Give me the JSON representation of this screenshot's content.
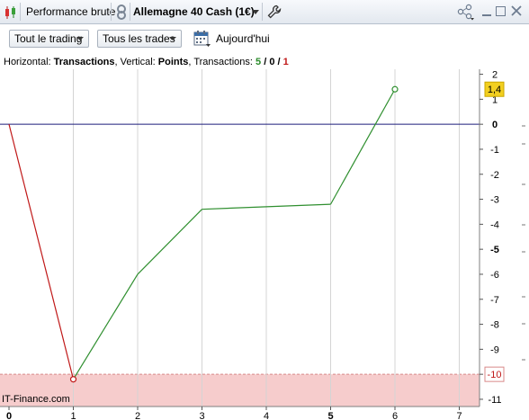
{
  "titlebar": {
    "perf_label": "Performance brute",
    "instrument": "Allemagne 40 Cash (1€)",
    "icons": [
      "candlestick-icon",
      "link-icon",
      "wrench-icon",
      "share-icon",
      "minimize-icon",
      "maximize-icon",
      "close-icon"
    ]
  },
  "toolbar": {
    "scope_select": "Tout le trading",
    "trades_select": "Tous les trades",
    "date_label": "Aujourd'hui"
  },
  "info": {
    "horizontal_label": "Horizontal: ",
    "horizontal_value": "Transactions",
    "vertical_label": ", Vertical: ",
    "vertical_value": "Points",
    "transactions_label": ", Transactions: ",
    "winners": "5",
    "slash1": " / ",
    "neutral": "0",
    "slash2": " / ",
    "losers": "1"
  },
  "colors": {
    "gain_line": "#2f8f2f",
    "loss_line": "#c01818",
    "zero_line": "#1c1c7a",
    "loss_zone": "#f6cccc",
    "last_value_badge": "#f2cf1f"
  },
  "chart_data": {
    "type": "line",
    "x": [
      0,
      1,
      2,
      3,
      4,
      5,
      6
    ],
    "y": [
      0,
      -10.2,
      -6.0,
      -3.4,
      -3.3,
      -3.2,
      1.4
    ],
    "segment_colors": [
      "loss",
      "gain",
      "gain",
      "gain",
      "gain",
      "gain"
    ],
    "markers": [
      1,
      6
    ],
    "xlim": [
      0,
      7.3
    ],
    "ylim": [
      -11.3,
      2.2
    ],
    "x_ticks": [
      "0",
      "1",
      "2",
      "3",
      "4",
      "5",
      "6",
      "7"
    ],
    "y_ticks": [
      "2",
      "1",
      "0",
      "-1",
      "-2",
      "-3",
      "-4",
      "-5",
      "-6",
      "-7",
      "-8",
      "-9",
      "-10",
      "-11"
    ],
    "bold_x_ticks": [
      "0",
      "5"
    ],
    "bold_y_ticks": [
      "0",
      "-5"
    ],
    "last_value_label": "1,4",
    "drawdown_label": "-10",
    "drawdown_level": -10,
    "grid": true,
    "watermark": "IT-Finance.com"
  }
}
